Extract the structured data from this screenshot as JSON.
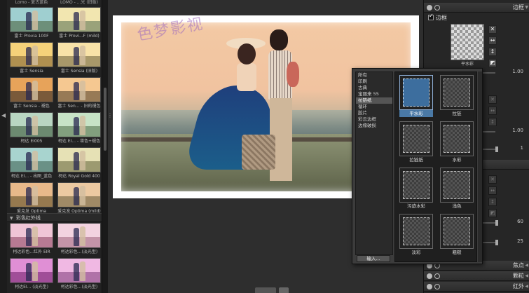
{
  "left": {
    "top_captions": [
      "Lomo - 复古蓝色",
      "LOMO - ...光 (旧版)"
    ],
    "presets_top": [
      {
        "label": "富士 Provia 100F",
        "sky": "#9fcfd0",
        "ground": "#6d8f7a"
      },
      {
        "label": "富士 Provi...F (mild)",
        "sky": "#f2e6b0",
        "ground": "#9aa27a"
      },
      {
        "label": "富士 Sensia",
        "sky": "#f6d27a",
        "ground": "#b09050"
      },
      {
        "label": "富士 Sensia (旧版)",
        "sky": "#f8e2a8",
        "ground": "#a8986a"
      },
      {
        "label": "富士 Sensia - 褪色",
        "sky": "#e7a35a",
        "ground": "#7a5a3a"
      },
      {
        "label": "富士 Sen... - 旧的褪色",
        "sky": "#f5c891",
        "ground": "#977a56"
      },
      {
        "label": "柯达 EI005",
        "sky": "#b9d6c2",
        "ground": "#6c8a70"
      },
      {
        "label": "柯达 EI... - 增色+褪色",
        "sky": "#c7e3c6",
        "ground": "#82a07e"
      },
      {
        "label": "柯达 EI... - 出图_蓝色",
        "sky": "#a8d4cf",
        "ground": "#6a9186"
      },
      {
        "label": "柯达 Royal Gold 400",
        "sky": "#e6e1b5",
        "ground": "#9c9a70"
      },
      {
        "label": "爱克发 Optima",
        "sky": "#e8b98a",
        "ground": "#96794f"
      },
      {
        "label": "爱克发 Optima (mild)",
        "sky": "#ecc9a1",
        "ground": "#a08a66"
      }
    ],
    "section_title": "彩色红外线",
    "presets_bottom": [
      {
        "label": "柯达彩色...红外 EIR",
        "sky": "#f0c5d6",
        "ground": "#b77a93"
      },
      {
        "label": "柯达彩色...(淡光型)",
        "sky": "#f3d3e0",
        "ground": "#c494a8"
      },
      {
        "label": "柯达EI... (淡光型)",
        "sky": "#e08fd5",
        "ground": "#a04e98"
      },
      {
        "label": "柯达彩色...(淡光型)",
        "sky": "#f0b8e3",
        "ground": "#b072a8"
      }
    ]
  },
  "canvas": {
    "watermark": "色梦影视"
  },
  "right": {
    "border_header": "边框",
    "border_checkbox": "边框",
    "frame_thumb_label": "平水彩",
    "slider_values": [
      "1.00",
      "1.00",
      "1",
      "60",
      "25"
    ],
    "headers_bottom": [
      "焦点",
      "颗粒",
      "红外"
    ]
  },
  "popup": {
    "categories": [
      "所有",
      "印刷",
      "古典",
      "宝丽来 55",
      "拉链纸",
      "循环",
      "胶片",
      "彩云边框",
      "边缘破损"
    ],
    "selected_category": 4,
    "import_label": "输入...",
    "frames": [
      {
        "label": "平水彩",
        "selected": true
      },
      {
        "label": "拉链"
      },
      {
        "label": "拉链纸"
      },
      {
        "label": "水彩"
      },
      {
        "label": "污迹水彩"
      },
      {
        "label": "浅色"
      },
      {
        "label": "淡彩"
      },
      {
        "label": "粗糙"
      }
    ]
  }
}
